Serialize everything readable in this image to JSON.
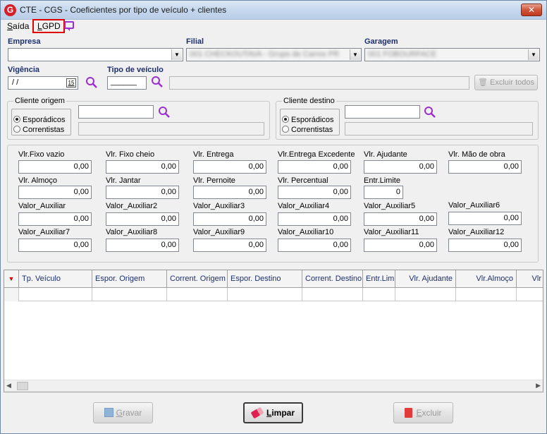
{
  "window": {
    "title": "CTE - CGS - Coeficientes por tipo de veículo + clientes",
    "close": "✕"
  },
  "menu": {
    "saida_first": "S",
    "saida_rest": "aída",
    "lgpd_first": "L",
    "lgpd_rest": "GPD"
  },
  "fields": {
    "empresa_label": "Empresa",
    "empresa_value": "",
    "filial_label": "Filial",
    "filial_value": "001 CHECKOUTAVA - Grupo de Carros PR",
    "garagem_label": "Garagem",
    "garagem_value": "001 FOBOURFACE",
    "vigencia_label": "Vigência",
    "vigencia_value": " /  /",
    "calendar_day": "15",
    "tipo_veiculo_label": "Tipo de veículo",
    "tipo_veiculo_value": "______",
    "excluir_todos": "Excluir todos"
  },
  "cliente_origem": {
    "title": "Cliente origem",
    "opt1": "Esporádicos",
    "opt2": "Correntistas"
  },
  "cliente_destino": {
    "title": "Cliente destino",
    "opt1": "Esporádicos",
    "opt2": "Correntistas"
  },
  "values": {
    "r1": [
      {
        "label": "Vlr.Fixo vazio",
        "value": "0,00"
      },
      {
        "label": "Vlr. Fixo cheio",
        "value": "0,00"
      },
      {
        "label": "Vlr. Entrega",
        "value": "0,00"
      },
      {
        "label": "Vlr.Entrega Excedente",
        "value": "0,00"
      },
      {
        "label": "Vlr. Ajudante",
        "value": "0,00"
      },
      {
        "label": "Vlr. Mão de obra",
        "value": "0,00"
      }
    ],
    "r2": [
      {
        "label": "Vlr. Almoço",
        "value": "0,00"
      },
      {
        "label": "Vlr. Jantar",
        "value": "0,00"
      },
      {
        "label": "Vlr. Pernoite",
        "value": "0,00"
      },
      {
        "label": "Vlr. Percentual",
        "value": "0,00"
      },
      {
        "label": "Entr.Limite",
        "value": "0"
      }
    ],
    "r3": [
      {
        "label": "Valor_Auxiliar",
        "value": "0,00"
      },
      {
        "label": "Valor_Auxiliar2",
        "value": "0,00"
      },
      {
        "label": "Valor_Auxiliar3",
        "value": "0,00"
      },
      {
        "label": "Valor_Auxiliar4",
        "value": "0,00"
      },
      {
        "label": "Valor_Auxiliar5",
        "value": "0,00"
      },
      {
        "label": "Valor_Auxiliar6",
        "value": "0,00"
      }
    ],
    "r4": [
      {
        "label": "Valor_Auxiliar7",
        "value": "0,00"
      },
      {
        "label": "Valor_Auxiliar8",
        "value": "0,00"
      },
      {
        "label": "Valor_Auxiliar9",
        "value": "0,00"
      },
      {
        "label": "Valor_Auxiliar10",
        "value": "0,00"
      },
      {
        "label": "Valor_Auxiliar11",
        "value": "0,00"
      },
      {
        "label": "Valor_Auxiliar12",
        "value": "0,00"
      }
    ]
  },
  "grid": {
    "columns": [
      "Tp. Veículo",
      "Espor. Origem",
      "Corrent. Origem",
      "Espor. Destino",
      "Corrent. Destino",
      "Entr.Lim",
      "Vlr. Ajudante",
      "Vlr.Almoço",
      "Vlr"
    ]
  },
  "buttons": {
    "gravar_first": "G",
    "gravar_rest": "ravar",
    "limpar_first": "L",
    "limpar_rest": "impar",
    "excluir_first": "E",
    "excluir_rest": "xcluir"
  },
  "colors": {
    "accent_label": "#1c2f6e",
    "search_icon": "#9b2fd2",
    "lgpd_highlight": "#e00000"
  }
}
